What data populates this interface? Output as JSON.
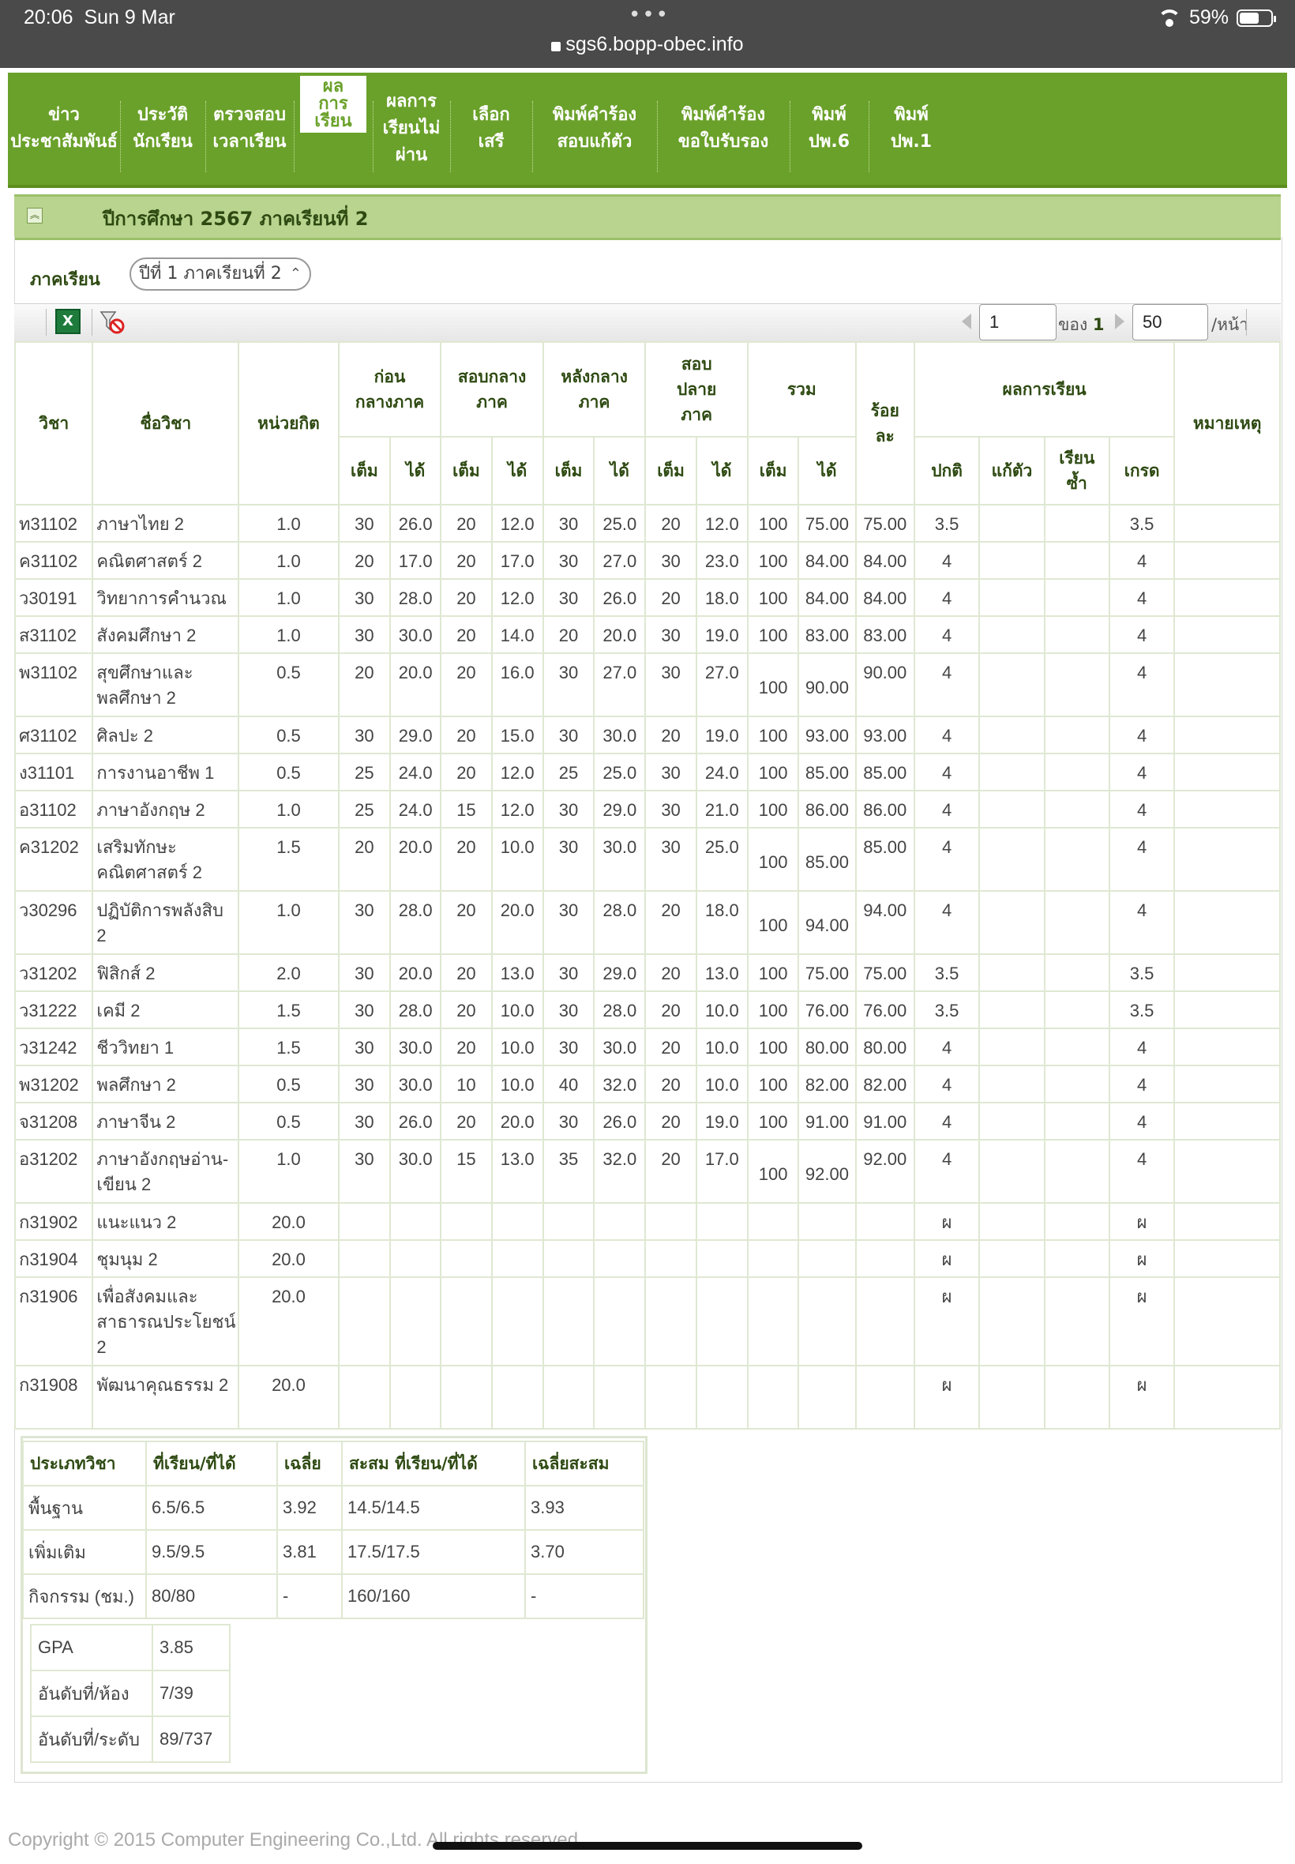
{
  "status": {
    "time": "20:06",
    "date": "Sun 9 Mar",
    "url": "sgs6.bopp-obec.info",
    "battery": "59%"
  },
  "nav": [
    {
      "label": "ข่าว\nประชาสัมพันธ์"
    },
    {
      "label": "ประวัติ\nนักเรียน"
    },
    {
      "label": "ตรวจสอบ\nเวลาเรียน"
    },
    {
      "label": "ผล\nการ\nเรียน",
      "active": true
    },
    {
      "label": "ผลการ\nเรียนไม่\nผ่าน"
    },
    {
      "label": "เลือก\nเสรี"
    },
    {
      "label": "พิมพ์คำร้อง\nสอบแก้ตัว"
    },
    {
      "label": "พิมพ์คำร้อง\nขอใบรับรอง"
    },
    {
      "label": "พิมพ์\nปพ.6"
    },
    {
      "label": "พิมพ์\nปพ.1"
    }
  ],
  "year_title": "ปีการศึกษา 2567 ภาคเรียนที่ 2",
  "semester": {
    "label": "ภาคเรียน",
    "selected": "ปีที่ 1 ภาคเรียนที่ 2"
  },
  "pager": {
    "page": "1",
    "of_label": "ของ",
    "total": "1",
    "size": "50",
    "per_label": "/หน้า"
  },
  "headers": {
    "code": "วิชา",
    "name": "ชื่อวิชา",
    "credit": "หน่วยกิต",
    "before_mid": "ก่อน\nกลางภาค",
    "mid": "สอบกลาง\nภาค",
    "after_mid": "หลังกลาง\nภาค",
    "final": "สอบ\nปลาย\nภาค",
    "total": "รวม",
    "percent": "ร้อย\nละ",
    "result": "ผลการเรียน",
    "remark": "หมายเหตุ",
    "full": "เต็ม",
    "got": "ได้",
    "normal": "ปกติ",
    "retest": "แก้ตัว",
    "repeat": "เรียน\nซ้ำ",
    "grade": "เกรด"
  },
  "rows": [
    {
      "code": "ท31102",
      "name": "ภาษาไทย 2",
      "credit": "1.0",
      "s": [
        "30",
        "26.0",
        "20",
        "12.0",
        "30",
        "25.0",
        "20",
        "12.0"
      ],
      "tf": "100",
      "tg": "75.00",
      "pct": "75.00",
      "normal": "3.5",
      "grade": "3.5"
    },
    {
      "code": "ค31102",
      "name": "คณิตศาสตร์ 2",
      "credit": "1.0",
      "s": [
        "20",
        "17.0",
        "20",
        "17.0",
        "30",
        "27.0",
        "30",
        "23.0"
      ],
      "tf": "100",
      "tg": "84.00",
      "pct": "84.00",
      "normal": "4",
      "grade": "4"
    },
    {
      "code": "ว30191",
      "name": "วิทยาการคำนวณ",
      "credit": "1.0",
      "s": [
        "30",
        "28.0",
        "20",
        "12.0",
        "30",
        "26.0",
        "20",
        "18.0"
      ],
      "tf": "100",
      "tg": "84.00",
      "pct": "84.00",
      "normal": "4",
      "grade": "4"
    },
    {
      "code": "ส31102",
      "name": "สังคมศึกษา 2",
      "credit": "1.0",
      "s": [
        "30",
        "30.0",
        "20",
        "14.0",
        "20",
        "20.0",
        "30",
        "19.0"
      ],
      "tf": "100",
      "tg": "83.00",
      "pct": "83.00",
      "normal": "4",
      "grade": "4"
    },
    {
      "code": "พ31102",
      "name": "สุขศึกษาและพลศึกษา 2",
      "credit": "0.5",
      "s": [
        "20",
        "20.0",
        "20",
        "16.0",
        "30",
        "27.0",
        "30",
        "27.0"
      ],
      "tf": "100",
      "tg": "90.00",
      "pct": "90.00",
      "normal": "4",
      "grade": "4",
      "tall": true
    },
    {
      "code": "ศ31102",
      "name": "ศิลปะ 2",
      "credit": "0.5",
      "s": [
        "30",
        "29.0",
        "20",
        "15.0",
        "30",
        "30.0",
        "20",
        "19.0"
      ],
      "tf": "100",
      "tg": "93.00",
      "pct": "93.00",
      "normal": "4",
      "grade": "4"
    },
    {
      "code": "ง31101",
      "name": "การงานอาชีพ 1",
      "credit": "0.5",
      "s": [
        "25",
        "24.0",
        "20",
        "12.0",
        "25",
        "25.0",
        "30",
        "24.0"
      ],
      "tf": "100",
      "tg": "85.00",
      "pct": "85.00",
      "normal": "4",
      "grade": "4"
    },
    {
      "code": "อ31102",
      "name": "ภาษาอังกฤษ 2",
      "credit": "1.0",
      "s": [
        "25",
        "24.0",
        "15",
        "12.0",
        "30",
        "29.0",
        "30",
        "21.0"
      ],
      "tf": "100",
      "tg": "86.00",
      "pct": "86.00",
      "normal": "4",
      "grade": "4"
    },
    {
      "code": "ค31202",
      "name": "เสริมทักษะคณิตศาสตร์ 2",
      "credit": "1.5",
      "s": [
        "20",
        "20.0",
        "20",
        "10.0",
        "30",
        "30.0",
        "30",
        "25.0"
      ],
      "tf": "100",
      "tg": "85.00",
      "pct": "85.00",
      "normal": "4",
      "grade": "4",
      "tall": true
    },
    {
      "code": "ว30296",
      "name": "ปฏิบัติการพลังสิบ 2",
      "credit": "1.0",
      "s": [
        "30",
        "28.0",
        "20",
        "20.0",
        "30",
        "28.0",
        "20",
        "18.0"
      ],
      "tf": "100",
      "tg": "94.00",
      "pct": "94.00",
      "normal": "4",
      "grade": "4",
      "tall": true
    },
    {
      "code": "ว31202",
      "name": "ฟิสิกส์ 2",
      "credit": "2.0",
      "s": [
        "30",
        "20.0",
        "20",
        "13.0",
        "30",
        "29.0",
        "20",
        "13.0"
      ],
      "tf": "100",
      "tg": "75.00",
      "pct": "75.00",
      "normal": "3.5",
      "grade": "3.5"
    },
    {
      "code": "ว31222",
      "name": "เคมี 2",
      "credit": "1.5",
      "s": [
        "30",
        "28.0",
        "20",
        "10.0",
        "30",
        "28.0",
        "20",
        "10.0"
      ],
      "tf": "100",
      "tg": "76.00",
      "pct": "76.00",
      "normal": "3.5",
      "grade": "3.5"
    },
    {
      "code": "ว31242",
      "name": "ชีววิทยา 1",
      "credit": "1.5",
      "s": [
        "30",
        "30.0",
        "20",
        "10.0",
        "30",
        "30.0",
        "20",
        "10.0"
      ],
      "tf": "100",
      "tg": "80.00",
      "pct": "80.00",
      "normal": "4",
      "grade": "4"
    },
    {
      "code": "พ31202",
      "name": "พลศึกษา 2",
      "credit": "0.5",
      "s": [
        "30",
        "30.0",
        "10",
        "10.0",
        "40",
        "32.0",
        "20",
        "10.0"
      ],
      "tf": "100",
      "tg": "82.00",
      "pct": "82.00",
      "normal": "4",
      "grade": "4"
    },
    {
      "code": "จ31208",
      "name": "ภาษาจีน 2",
      "credit": "0.5",
      "s": [
        "30",
        "26.0",
        "20",
        "20.0",
        "30",
        "26.0",
        "20",
        "19.0"
      ],
      "tf": "100",
      "tg": "91.00",
      "pct": "91.00",
      "normal": "4",
      "grade": "4"
    },
    {
      "code": "อ31202",
      "name": "ภาษาอังกฤษอ่าน-เขียน 2",
      "credit": "1.0",
      "s": [
        "30",
        "30.0",
        "15",
        "13.0",
        "35",
        "32.0",
        "20",
        "17.0"
      ],
      "tf": "100",
      "tg": "92.00",
      "pct": "92.00",
      "normal": "4",
      "grade": "4",
      "tall": true
    },
    {
      "code": "ก31902",
      "name": "แนะแนว 2",
      "credit": "20.0",
      "s": [
        "",
        "",
        "",
        "",
        "",
        "",
        "",
        ""
      ],
      "tf": "",
      "tg": "",
      "pct": "",
      "normal": "ผ",
      "grade": "ผ"
    },
    {
      "code": "ก31904",
      "name": "ชุมนุม 2",
      "credit": "20.0",
      "s": [
        "",
        "",
        "",
        "",
        "",
        "",
        "",
        ""
      ],
      "tf": "",
      "tg": "",
      "pct": "",
      "normal": "ผ",
      "grade": "ผ"
    },
    {
      "code": "ก31906",
      "name": "เพื่อสังคมและสาธารณประโยชน์ 2",
      "credit": "20.0",
      "s": [
        "",
        "",
        "",
        "",
        "",
        "",
        "",
        ""
      ],
      "tf": "",
      "tg": "",
      "pct": "",
      "normal": "ผ",
      "grade": "ผ",
      "xtall": true
    },
    {
      "code": "ก31908",
      "name": "พัฒนาคุณธรรม 2",
      "credit": "20.0",
      "s": [
        "",
        "",
        "",
        "",
        "",
        "",
        "",
        ""
      ],
      "tf": "",
      "tg": "",
      "pct": "",
      "normal": "ผ",
      "grade": "ผ",
      "tall": true
    }
  ],
  "summary": {
    "headers": [
      "ประเภทวิชา",
      "ที่เรียน/ที่ได้",
      "เฉลี่ย",
      "สะสม ที่เรียน/ที่ได้",
      "เฉลี่ยสะสม"
    ],
    "rows": [
      [
        "พื้นฐาน",
        "6.5/6.5",
        "3.92",
        "14.5/14.5",
        "3.93"
      ],
      [
        "เพิ่มเติม",
        "9.5/9.5",
        "3.81",
        "17.5/17.5",
        "3.70"
      ],
      [
        "กิจกรรม (ชม.)",
        "80/80",
        "-",
        "160/160",
        "-"
      ]
    ]
  },
  "gpa": [
    {
      "label": "GPA",
      "value": "3.85"
    },
    {
      "label": "อันดับที่/ห้อง",
      "value": "7/39"
    },
    {
      "label": "อันดับที่/ระดับ",
      "value": "89/737"
    }
  ],
  "copyright": "Copyright © 2015 Computer Engineering Co.,Ltd. All rights reserved."
}
